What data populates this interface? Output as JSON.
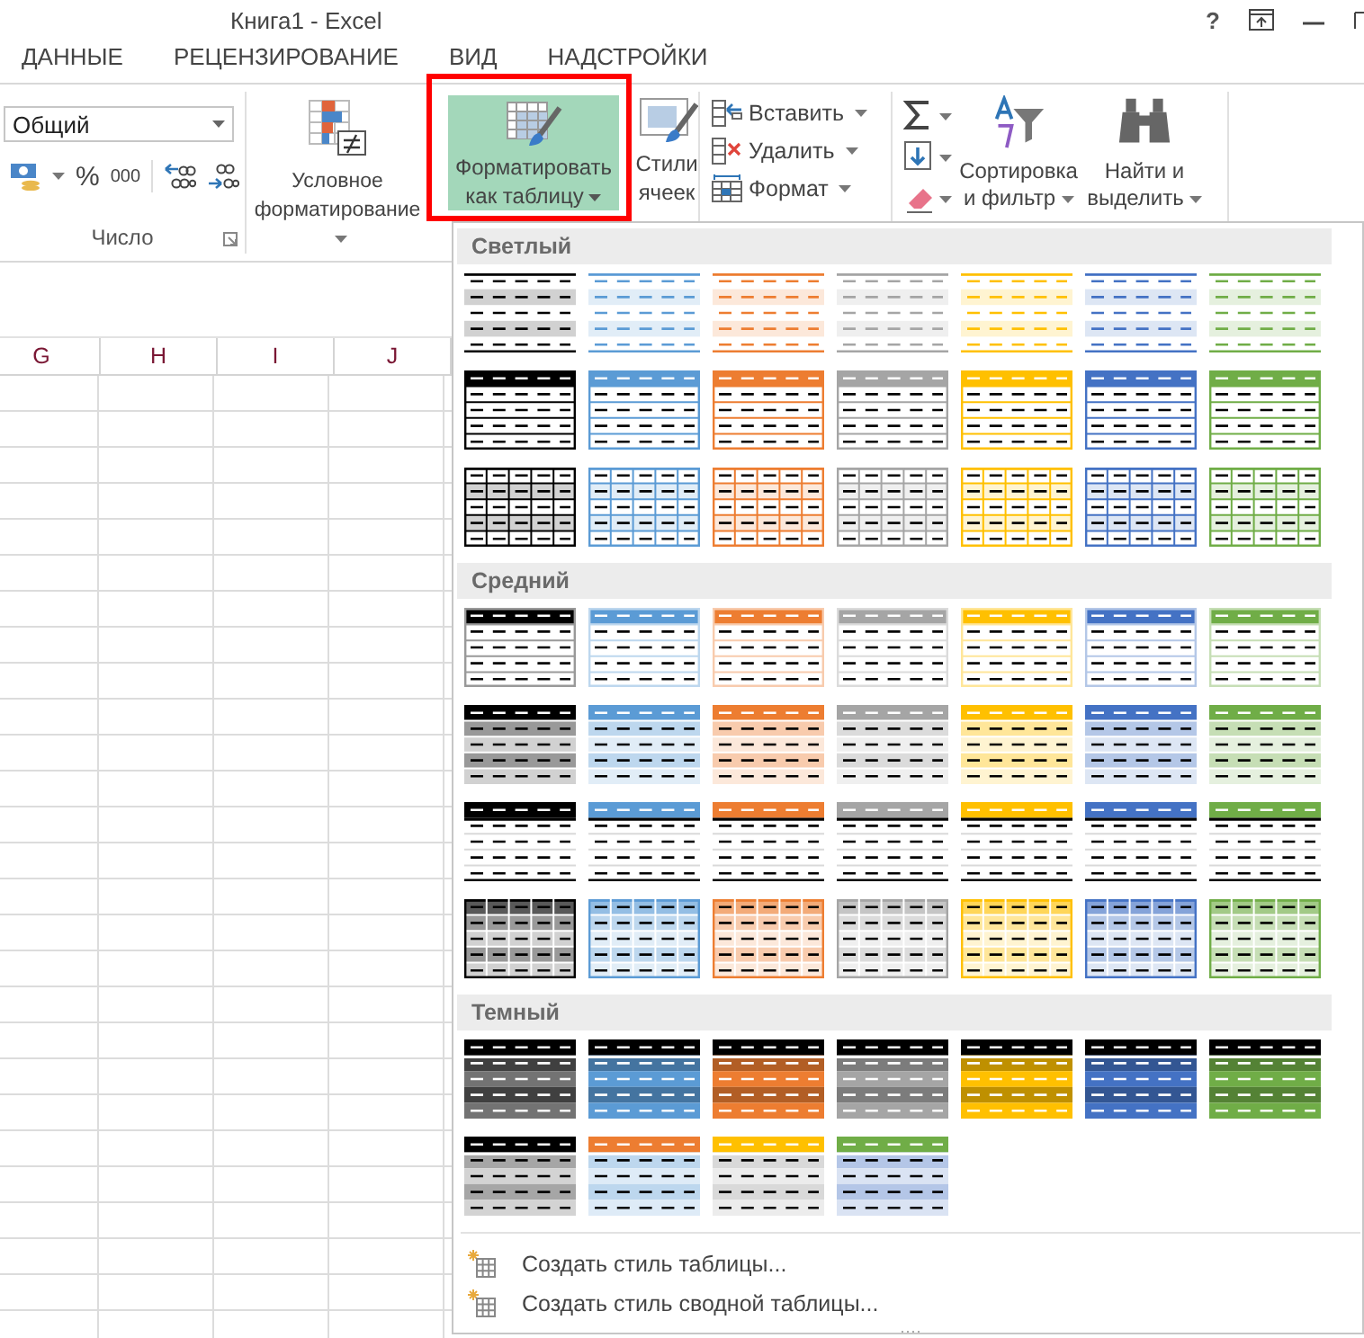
{
  "window": {
    "title": "Книга1 - Excel",
    "help": "?"
  },
  "tabs": [
    {
      "label": "ДАННЫЕ",
      "selected": false
    },
    {
      "label": "РЕЦЕНЗИРОВАНИЕ",
      "selected": false
    },
    {
      "label": "ВИД",
      "selected": false
    },
    {
      "label": "НАДСТРОЙКИ",
      "selected": false
    }
  ],
  "ribbon": {
    "number_group": {
      "format": "Общий",
      "percent": "%",
      "thousands": "000",
      "label": "Число"
    },
    "styles_group": {
      "conditional": "Условное форматирование",
      "format_table": {
        "label": "Форматировать как таблицу",
        "expanded": true
      },
      "cell_styles": "Стили ячеек"
    },
    "cells_group": [
      {
        "kind": "insert",
        "label": "Вставить"
      },
      {
        "kind": "delete",
        "label": "Удалить"
      },
      {
        "kind": "format",
        "label": "Формат"
      }
    ],
    "editing_group": {
      "sort": "Сортировка и фильтр",
      "find": "Найти и выделить"
    }
  },
  "sheet": {
    "columns": [
      "G",
      "H",
      "I",
      "J"
    ]
  },
  "gallery": {
    "sections": [
      {
        "title": "Светлый",
        "rows": [
          {
            "styles": [
              {
                "kind": "light-banded",
                "color": "#000000"
              },
              {
                "kind": "light-banded",
                "color": "#5b9bd5"
              },
              {
                "kind": "light-banded",
                "color": "#ed7d31"
              },
              {
                "kind": "light-banded",
                "color": "#a5a5a5"
              },
              {
                "kind": "light-banded",
                "color": "#ffc000"
              },
              {
                "kind": "light-banded",
                "color": "#4472c4"
              },
              {
                "kind": "light-banded",
                "color": "#70ad47"
              }
            ]
          },
          {
            "styles": [
              {
                "kind": "light-header",
                "color": "#000000"
              },
              {
                "kind": "light-header",
                "color": "#5b9bd5"
              },
              {
                "kind": "light-header",
                "color": "#ed7d31"
              },
              {
                "kind": "light-header",
                "color": "#a5a5a5"
              },
              {
                "kind": "light-header",
                "color": "#ffc000"
              },
              {
                "kind": "light-header",
                "color": "#4472c4"
              },
              {
                "kind": "light-header",
                "color": "#70ad47"
              }
            ]
          },
          {
            "styles": [
              {
                "kind": "light-grid",
                "color": "#000000"
              },
              {
                "kind": "light-grid",
                "color": "#5b9bd5"
              },
              {
                "kind": "light-grid",
                "color": "#ed7d31"
              },
              {
                "kind": "light-grid",
                "color": "#a5a5a5"
              },
              {
                "kind": "light-grid",
                "color": "#ffc000"
              },
              {
                "kind": "light-grid",
                "color": "#4472c4"
              },
              {
                "kind": "light-grid",
                "color": "#70ad47"
              }
            ]
          }
        ]
      },
      {
        "title": "Средний",
        "rows": [
          {
            "styles": [
              {
                "kind": "medium-header",
                "color": "#000000"
              },
              {
                "kind": "medium-header",
                "color": "#5b9bd5"
              },
              {
                "kind": "medium-header",
                "color": "#ed7d31"
              },
              {
                "kind": "medium-header",
                "color": "#a5a5a5"
              },
              {
                "kind": "medium-header",
                "color": "#ffc000"
              },
              {
                "kind": "medium-header",
                "color": "#4472c4"
              },
              {
                "kind": "medium-header",
                "color": "#70ad47"
              }
            ]
          },
          {
            "styles": [
              {
                "kind": "medium-banded",
                "color": "#000000"
              },
              {
                "kind": "medium-banded",
                "color": "#5b9bd5"
              },
              {
                "kind": "medium-banded",
                "color": "#ed7d31"
              },
              {
                "kind": "medium-banded",
                "color": "#a5a5a5"
              },
              {
                "kind": "medium-banded",
                "color": "#ffc000"
              },
              {
                "kind": "medium-banded",
                "color": "#4472c4"
              },
              {
                "kind": "medium-banded",
                "color": "#70ad47"
              }
            ]
          },
          {
            "styles": [
              {
                "kind": "medium-plain",
                "color": "#000000"
              },
              {
                "kind": "medium-plain",
                "color": "#5b9bd5"
              },
              {
                "kind": "medium-plain",
                "color": "#ed7d31"
              },
              {
                "kind": "medium-plain",
                "color": "#a5a5a5"
              },
              {
                "kind": "medium-plain",
                "color": "#ffc000"
              },
              {
                "kind": "medium-plain",
                "color": "#4472c4"
              },
              {
                "kind": "medium-plain",
                "color": "#70ad47"
              }
            ]
          },
          {
            "styles": [
              {
                "kind": "medium-strong",
                "color": "#000000"
              },
              {
                "kind": "medium-strong",
                "color": "#5b9bd5"
              },
              {
                "kind": "medium-strong",
                "color": "#ed7d31"
              },
              {
                "kind": "medium-strong",
                "color": "#a5a5a5"
              },
              {
                "kind": "medium-strong",
                "color": "#ffc000"
              },
              {
                "kind": "medium-strong",
                "color": "#4472c4"
              },
              {
                "kind": "medium-strong",
                "color": "#70ad47"
              }
            ]
          }
        ]
      },
      {
        "title": "Темный",
        "rows": [
          {
            "styles": [
              {
                "kind": "dark-banded",
                "color": "#000000"
              },
              {
                "kind": "dark-banded",
                "color": "#5b9bd5"
              },
              {
                "kind": "dark-banded",
                "color": "#ed7d31"
              },
              {
                "kind": "dark-banded",
                "color": "#a5a5a5"
              },
              {
                "kind": "dark-banded",
                "color": "#ffc000"
              },
              {
                "kind": "dark-banded",
                "color": "#4472c4"
              },
              {
                "kind": "dark-banded",
                "color": "#70ad47"
              }
            ]
          },
          {
            "styles": [
              {
                "kind": "dark-header-gray-body",
                "color": "#000000"
              },
              {
                "kind": "dark-header-blue-body",
                "color": "#ed7d31"
              },
              {
                "kind": "dark-header-gray-body",
                "color": "#ffc000"
              },
              {
                "kind": "dark-header-blue-body",
                "color": "#70ad47"
              }
            ]
          }
        ]
      }
    ],
    "commands": [
      "Создать стиль таблицы...",
      "Создать стиль сводной таблицы..."
    ]
  }
}
